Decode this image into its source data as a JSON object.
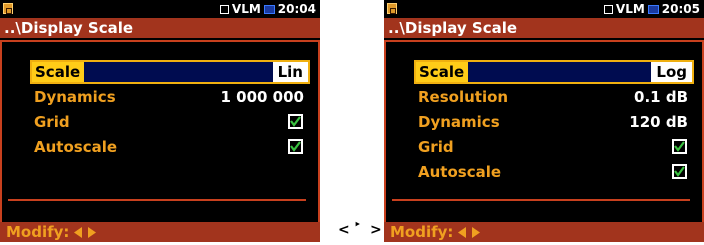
{
  "screens": [
    {
      "status": {
        "mode": "VLM",
        "time": "20:04"
      },
      "title": "..\\Display Scale",
      "items": [
        {
          "label": "Scale",
          "value": "Lin"
        },
        {
          "label": "Dynamics",
          "value": "1 000 000"
        },
        {
          "label": "Grid",
          "value": "",
          "checked": true
        },
        {
          "label": "Autoscale",
          "value": "",
          "checked": true
        }
      ],
      "footer": {
        "label": "Modify:",
        "left_icon": "left-arrow-icon",
        "right_icon": "right-arrow-icon"
      }
    },
    {
      "status": {
        "mode": "VLM",
        "time": "20:05"
      },
      "title": "..\\Display Scale",
      "items": [
        {
          "label": "Scale",
          "value": "Log"
        },
        {
          "label": "Resolution",
          "value": "0.1 dB"
        },
        {
          "label": "Dynamics",
          "value": "120 dB"
        },
        {
          "label": "Grid",
          "value": "",
          "checked": true
        },
        {
          "label": "Autoscale",
          "value": "",
          "checked": true
        }
      ],
      "footer": {
        "label": "Modify:",
        "left_icon": "left-arrow-icon",
        "right_icon": "right-arrow-icon"
      }
    }
  ],
  "transition": {
    "left": "<",
    "small": "‣",
    "right": ">"
  },
  "colors": {
    "background": "#000000",
    "title_bar": "#a2341d",
    "frame": "#c8401e",
    "label": "#f0a020",
    "value": "#ffffff",
    "selection": "#ffcc18",
    "checkmark": "#3ac040",
    "clock_icon": "#3a7aff"
  }
}
